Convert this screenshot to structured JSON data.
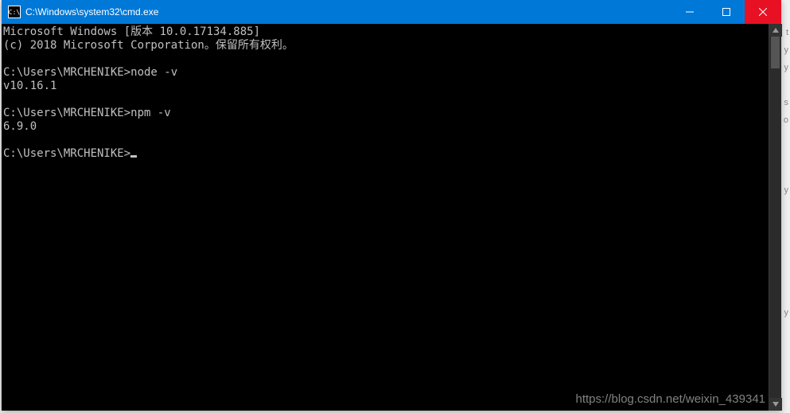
{
  "window": {
    "title": "C:\\Windows\\system32\\cmd.exe",
    "icon_label": "C:\\"
  },
  "terminal": {
    "lines": [
      "Microsoft Windows [版本 10.0.17134.885]",
      "(c) 2018 Microsoft Corporation。保留所有权利。",
      "",
      "C:\\Users\\MRCHENIKE>node -v",
      "v10.16.1",
      "",
      "C:\\Users\\MRCHENIKE>npm -v",
      "6.9.0",
      "",
      "C:\\Users\\MRCHENIKE>"
    ],
    "cursor_on_last": true
  },
  "background_fragments": [
    "t",
    "y",
    "y",
    "",
    "s",
    "o",
    "",
    "",
    "",
    "y",
    "",
    "",
    "",
    "",
    "",
    "",
    "y"
  ],
  "watermark": "https://blog.csdn.net/weixin_439341"
}
